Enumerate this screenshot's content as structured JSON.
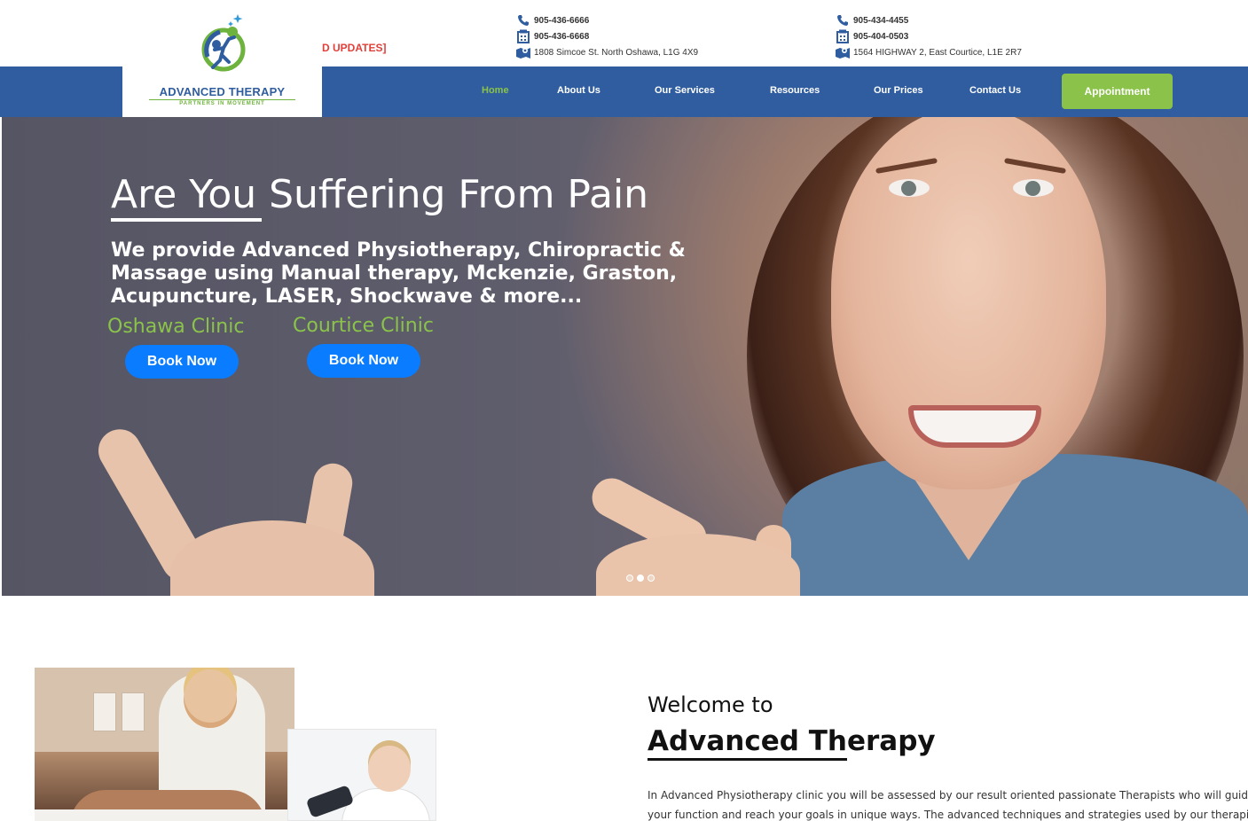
{
  "topbar": {
    "ticker": "D UPDATES]",
    "oshawa": {
      "phone": "905-436-6666",
      "fax": "905-436-6668",
      "address": "1808 Simcoe St. North Oshawa, L1G 4X9"
    },
    "courtice": {
      "phone": "905-434-4455",
      "fax": "905-404-0503",
      "address": "1564 HIGHWAY 2, East Courtice, L1E 2R7"
    }
  },
  "logo": {
    "name": "ADVANCED THERAPY",
    "tagline": "PARTNERS IN MOVEMENT"
  },
  "nav": {
    "items": [
      "Home",
      "About Us",
      "Our Services",
      "Resources",
      "Our Prices",
      "Contact Us"
    ],
    "active": "Home",
    "cta": "Appointment"
  },
  "hero": {
    "title": "Are You Suffering From Pain",
    "description": "We provide Advanced Physiotherapy, Chiropractic & Massage using Manual therapy, Mckenzie, Graston, Acupuncture, LASER, Shockwave & more...",
    "clinic1": "Oshawa Clinic",
    "clinic2": "Courtice Clinic",
    "book_label": "Book Now",
    "slides": 3,
    "active_slide": 2
  },
  "welcome": {
    "small": "Welcome to",
    "big": "Advanced Therapy",
    "line1": "In Advanced Physiotherapy clinic you will be assessed by our result oriented passionate Therapists who will guide",
    "line2": "your function and reach your goals in unique ways. The advanced techniques and strategies used by our therapi"
  },
  "colors": {
    "nav_blue": "#2f5d9f",
    "accent_green": "#8bc34a",
    "button_blue": "#0a7cff",
    "ticker_red": "#e0403a"
  }
}
